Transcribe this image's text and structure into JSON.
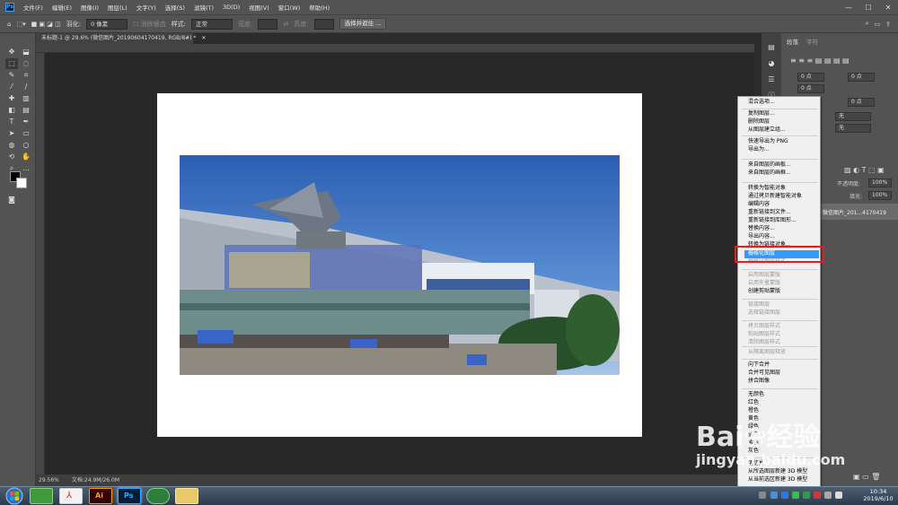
{
  "app": {
    "icon_label": "Ps"
  },
  "menubar": {
    "items": [
      "文件(F)",
      "编辑(E)",
      "图像(I)",
      "图层(L)",
      "文字(Y)",
      "选择(S)",
      "滤镜(T)",
      "3D(D)",
      "视图(V)",
      "窗口(W)",
      "帮助(H)"
    ],
    "window_controls": [
      "—",
      "☐",
      "✕"
    ]
  },
  "options": {
    "feather_label": "羽化:",
    "feather_value": "0 像素",
    "antialias": "消除锯齿",
    "style_label": "样式:",
    "style_value": "正常",
    "width_label": "宽度:",
    "height_label": "高度:",
    "select_mask": "选择并遮住 ..."
  },
  "document": {
    "tab_title": "未标题-1 @ 29.6% (微信图片_20190604170419, RGB/8#) *",
    "tab_close": "✕"
  },
  "status": {
    "zoom": "29.56%",
    "doc_size": "文档:24.9M/26.0M"
  },
  "panels": {
    "tab1": "段落",
    "tab2": "字符",
    "indent_values": [
      "0 点",
      "0 点",
      "0 点",
      "0 点"
    ],
    "hyphen_value": "无",
    "opacity_label": "不透明度:",
    "opacity_value": "100%",
    "fill_label": "填充:",
    "fill_value": "100%",
    "layer_name": "微信图片_201...4170419"
  },
  "context_menu": {
    "items": [
      {
        "label": "混合选项...",
        "enabled": true
      },
      {
        "label": "复制图层...",
        "enabled": true
      },
      {
        "label": "删除图层",
        "enabled": true
      },
      {
        "label": "从图层建立组...",
        "enabled": true
      },
      {
        "label": "快速导出为 PNG",
        "enabled": true
      },
      {
        "label": "导出为...",
        "enabled": true
      },
      {
        "label": "来自图层的画板...",
        "enabled": true
      },
      {
        "label": "来自图层的画框...",
        "enabled": true
      },
      {
        "label": "转换为智能对象",
        "enabled": true
      },
      {
        "label": "通过拷贝新建智能对象",
        "enabled": true
      },
      {
        "label": "编辑内容",
        "enabled": true
      },
      {
        "label": "重新链接到文件...",
        "enabled": true
      },
      {
        "label": "重新链接到库图形...",
        "enabled": true
      },
      {
        "label": "替换内容...",
        "enabled": true
      },
      {
        "label": "导出内容...",
        "enabled": true
      },
      {
        "label": "转换为链接对象...",
        "enabled": true
      },
      {
        "label": "栅格化图层",
        "enabled": true,
        "highlighted": true
      },
      {
        "label": "栅格化图层样式",
        "enabled": false
      },
      {
        "label": "启用图层蒙版",
        "enabled": false
      },
      {
        "label": "启用矢量蒙版",
        "enabled": false
      },
      {
        "label": "创建剪贴蒙版",
        "enabled": true
      },
      {
        "label": "链接图层",
        "enabled": false
      },
      {
        "label": "选择链接图层",
        "enabled": false
      },
      {
        "label": "拷贝图层样式",
        "enabled": false
      },
      {
        "label": "粘贴图层样式",
        "enabled": false
      },
      {
        "label": "清除图层样式",
        "enabled": false
      },
      {
        "label": "从隔离图层释放",
        "enabled": false
      },
      {
        "label": "向下合并",
        "enabled": true
      },
      {
        "label": "合并可见图层",
        "enabled": true
      },
      {
        "label": "拼合图像",
        "enabled": true
      },
      {
        "label": "无颜色",
        "enabled": true
      },
      {
        "label": "红色",
        "enabled": true
      },
      {
        "label": "橙色",
        "enabled": true
      },
      {
        "label": "黄色",
        "enabled": true
      },
      {
        "label": "绿色",
        "enabled": true
      },
      {
        "label": "蓝色",
        "enabled": true
      },
      {
        "label": "紫色",
        "enabled": true
      },
      {
        "label": "灰色",
        "enabled": true
      },
      {
        "label": "明信片",
        "enabled": true
      },
      {
        "label": "从所选图层新建 3D 模型",
        "enabled": true
      },
      {
        "label": "从当前选区新建 3D 模型",
        "enabled": true
      }
    ]
  },
  "taskbar": {
    "time": "10:34",
    "date": "2019/6/10",
    "ai_label": "Ai",
    "ps_label": "Ps"
  },
  "watermark": {
    "brand": "Bai",
    "brand2": "经验",
    "url": "jingyan.baidu.com"
  },
  "colors": {
    "highlight": "#3399ff",
    "red_box": "#e02020",
    "ps_blue": "#31a8ff"
  }
}
